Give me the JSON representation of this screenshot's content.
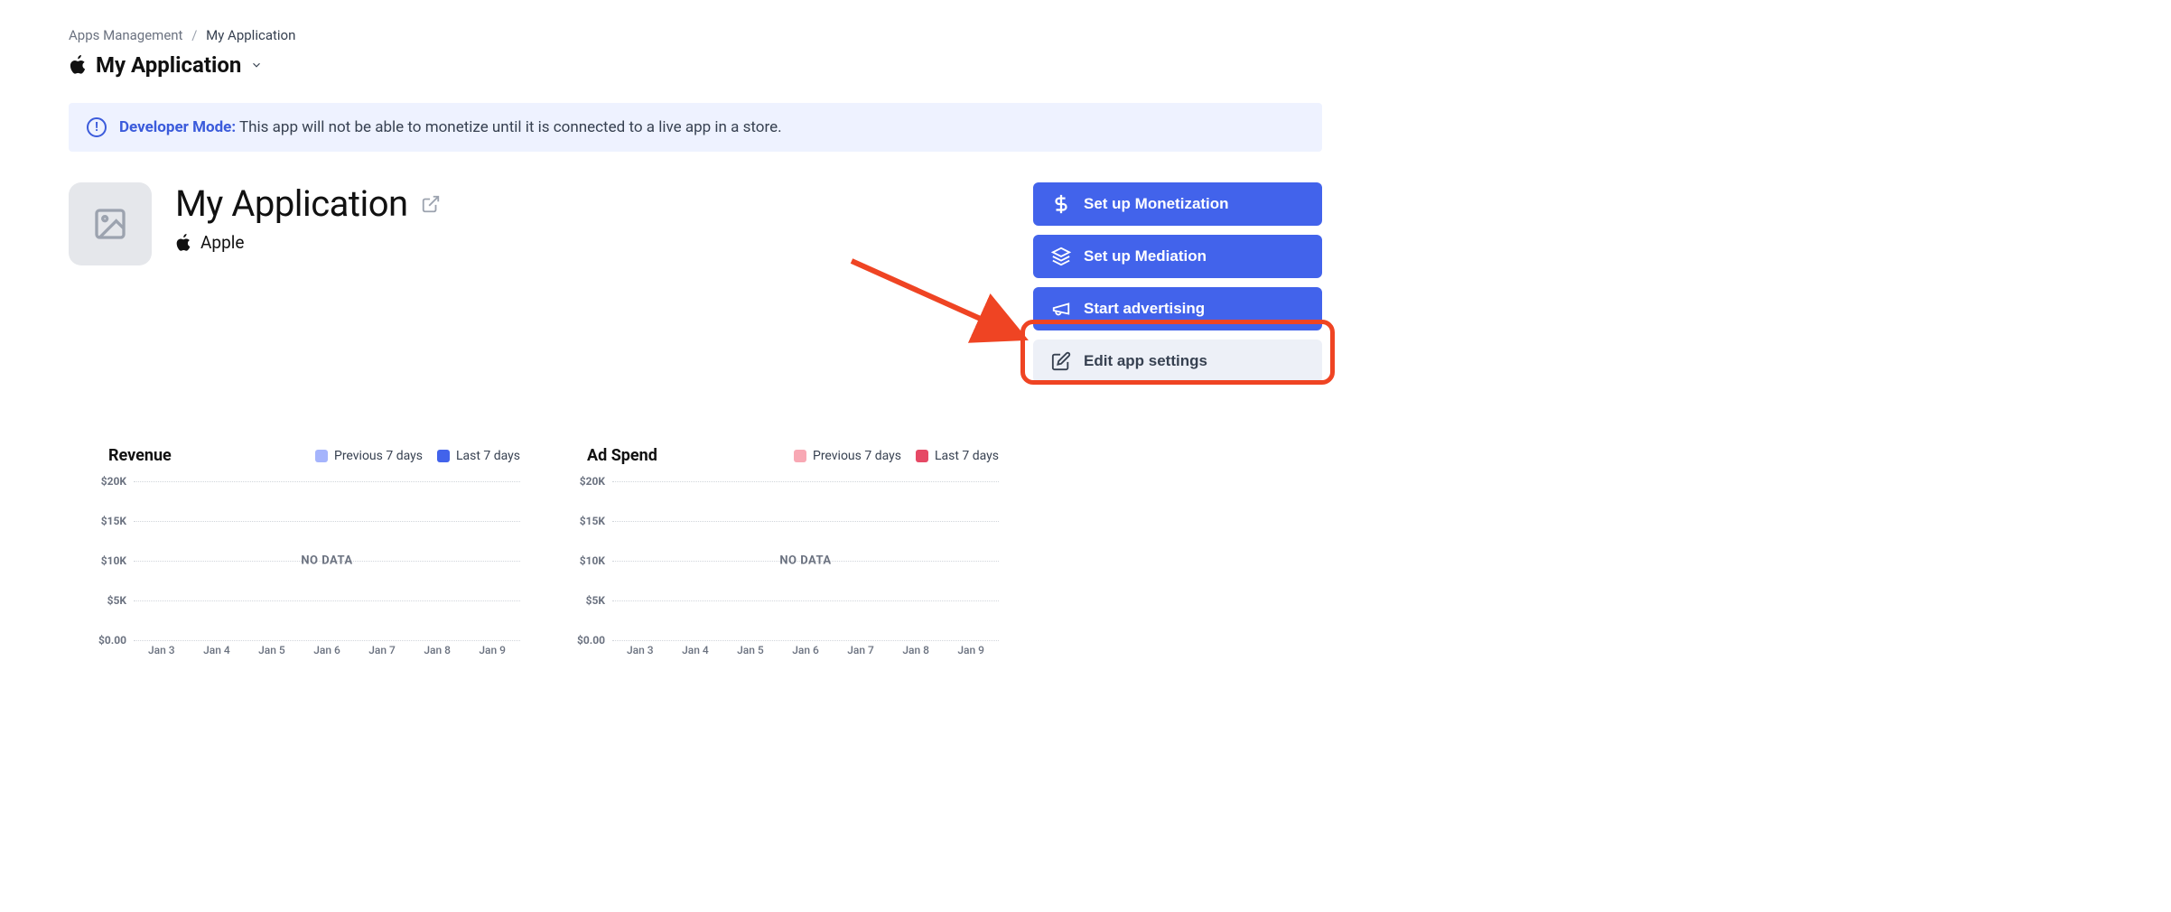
{
  "breadcrumb": {
    "parent": "Apps Management",
    "current": "My Application"
  },
  "app_switcher": {
    "name": "My Application"
  },
  "banner": {
    "label": "Developer Mode:",
    "text": "This app will not be able to monetize until it is connected to a live app in a store."
  },
  "hero": {
    "title": "My Application",
    "platform": "Apple"
  },
  "actions": {
    "monetization": "Set up Monetization",
    "mediation": "Set up Mediation",
    "advertising": "Start advertising",
    "edit_settings": "Edit app settings"
  },
  "chart_data": [
    {
      "type": "line",
      "title": "Revenue",
      "categories": [
        "Jan 3",
        "Jan 4",
        "Jan 5",
        "Jan 6",
        "Jan 7",
        "Jan 8",
        "Jan 9"
      ],
      "series": [
        {
          "name": "Previous 7 days",
          "color": "#a5b4fc",
          "values": [
            null,
            null,
            null,
            null,
            null,
            null,
            null
          ]
        },
        {
          "name": "Last 7 days",
          "color": "#4263eb",
          "values": [
            null,
            null,
            null,
            null,
            null,
            null,
            null
          ]
        }
      ],
      "yticks": [
        "$20K",
        "$15K",
        "$10K",
        "$5K",
        "$0.00"
      ],
      "ylim": [
        0,
        20000
      ],
      "empty_message": "NO DATA"
    },
    {
      "type": "line",
      "title": "Ad Spend",
      "categories": [
        "Jan 3",
        "Jan 4",
        "Jan 5",
        "Jan 6",
        "Jan 7",
        "Jan 8",
        "Jan 9"
      ],
      "series": [
        {
          "name": "Previous 7 days",
          "color": "#f8a8b4",
          "values": [
            null,
            null,
            null,
            null,
            null,
            null,
            null
          ]
        },
        {
          "name": "Last 7 days",
          "color": "#e64965",
          "values": [
            null,
            null,
            null,
            null,
            null,
            null,
            null
          ]
        }
      ],
      "yticks": [
        "$20K",
        "$15K",
        "$10K",
        "$5K",
        "$0.00"
      ],
      "ylim": [
        0,
        20000
      ],
      "empty_message": "NO DATA"
    }
  ]
}
